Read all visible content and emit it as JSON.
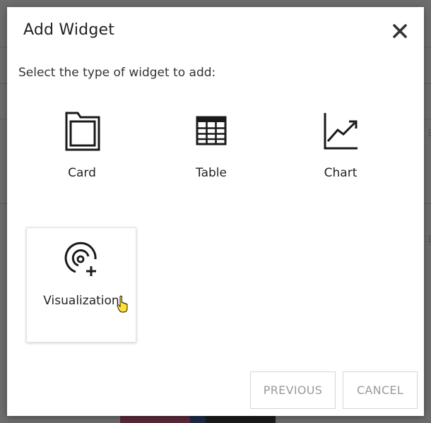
{
  "dialog": {
    "title": "Add Widget",
    "subtitle": "Select the type of widget to add:",
    "close_icon": "close-icon",
    "widgets": [
      {
        "label": "Card",
        "icon": "card-icon",
        "selected": false
      },
      {
        "label": "Table",
        "icon": "table-icon",
        "selected": false
      },
      {
        "label": "Chart",
        "icon": "chart-icon",
        "selected": false
      },
      {
        "label": "Visualization",
        "icon": "visualization-add-icon",
        "selected": true
      }
    ],
    "buttons": {
      "previous_label": "PREVIOUS",
      "cancel_label": "CANCEL"
    }
  },
  "colors": {
    "overlay": "#6d6d6d",
    "dialog_bg": "#ffffff",
    "text": "#222222",
    "button_text_disabled": "#9a9a9a",
    "button_border": "#d6d6d6",
    "cursor_fill": "#ffe033"
  }
}
